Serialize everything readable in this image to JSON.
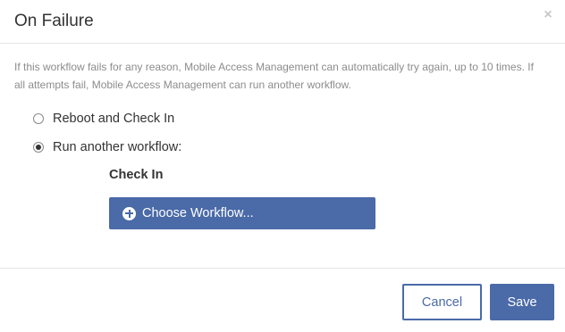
{
  "dialog": {
    "title": "On Failure",
    "close_glyph": "×",
    "description": "If this workflow fails for any reason, Mobile Access Management can automatically try again, up to 10 times. If all attempts fail, Mobile Access Management can run another workflow."
  },
  "options": [
    {
      "label": "Reboot and Check In",
      "checked": false
    },
    {
      "label": "Run another workflow:",
      "checked": true
    }
  ],
  "selected_workflow": "Check In",
  "choose_button": {
    "label": "Choose Workflow...",
    "icon": "plus-circle-icon"
  },
  "footer": {
    "cancel_label": "Cancel",
    "save_label": "Save"
  },
  "colors": {
    "accent": "#4a6aa8",
    "text": "#333333",
    "muted_text": "#8c8c8c",
    "divider": "#e5e5e5"
  }
}
